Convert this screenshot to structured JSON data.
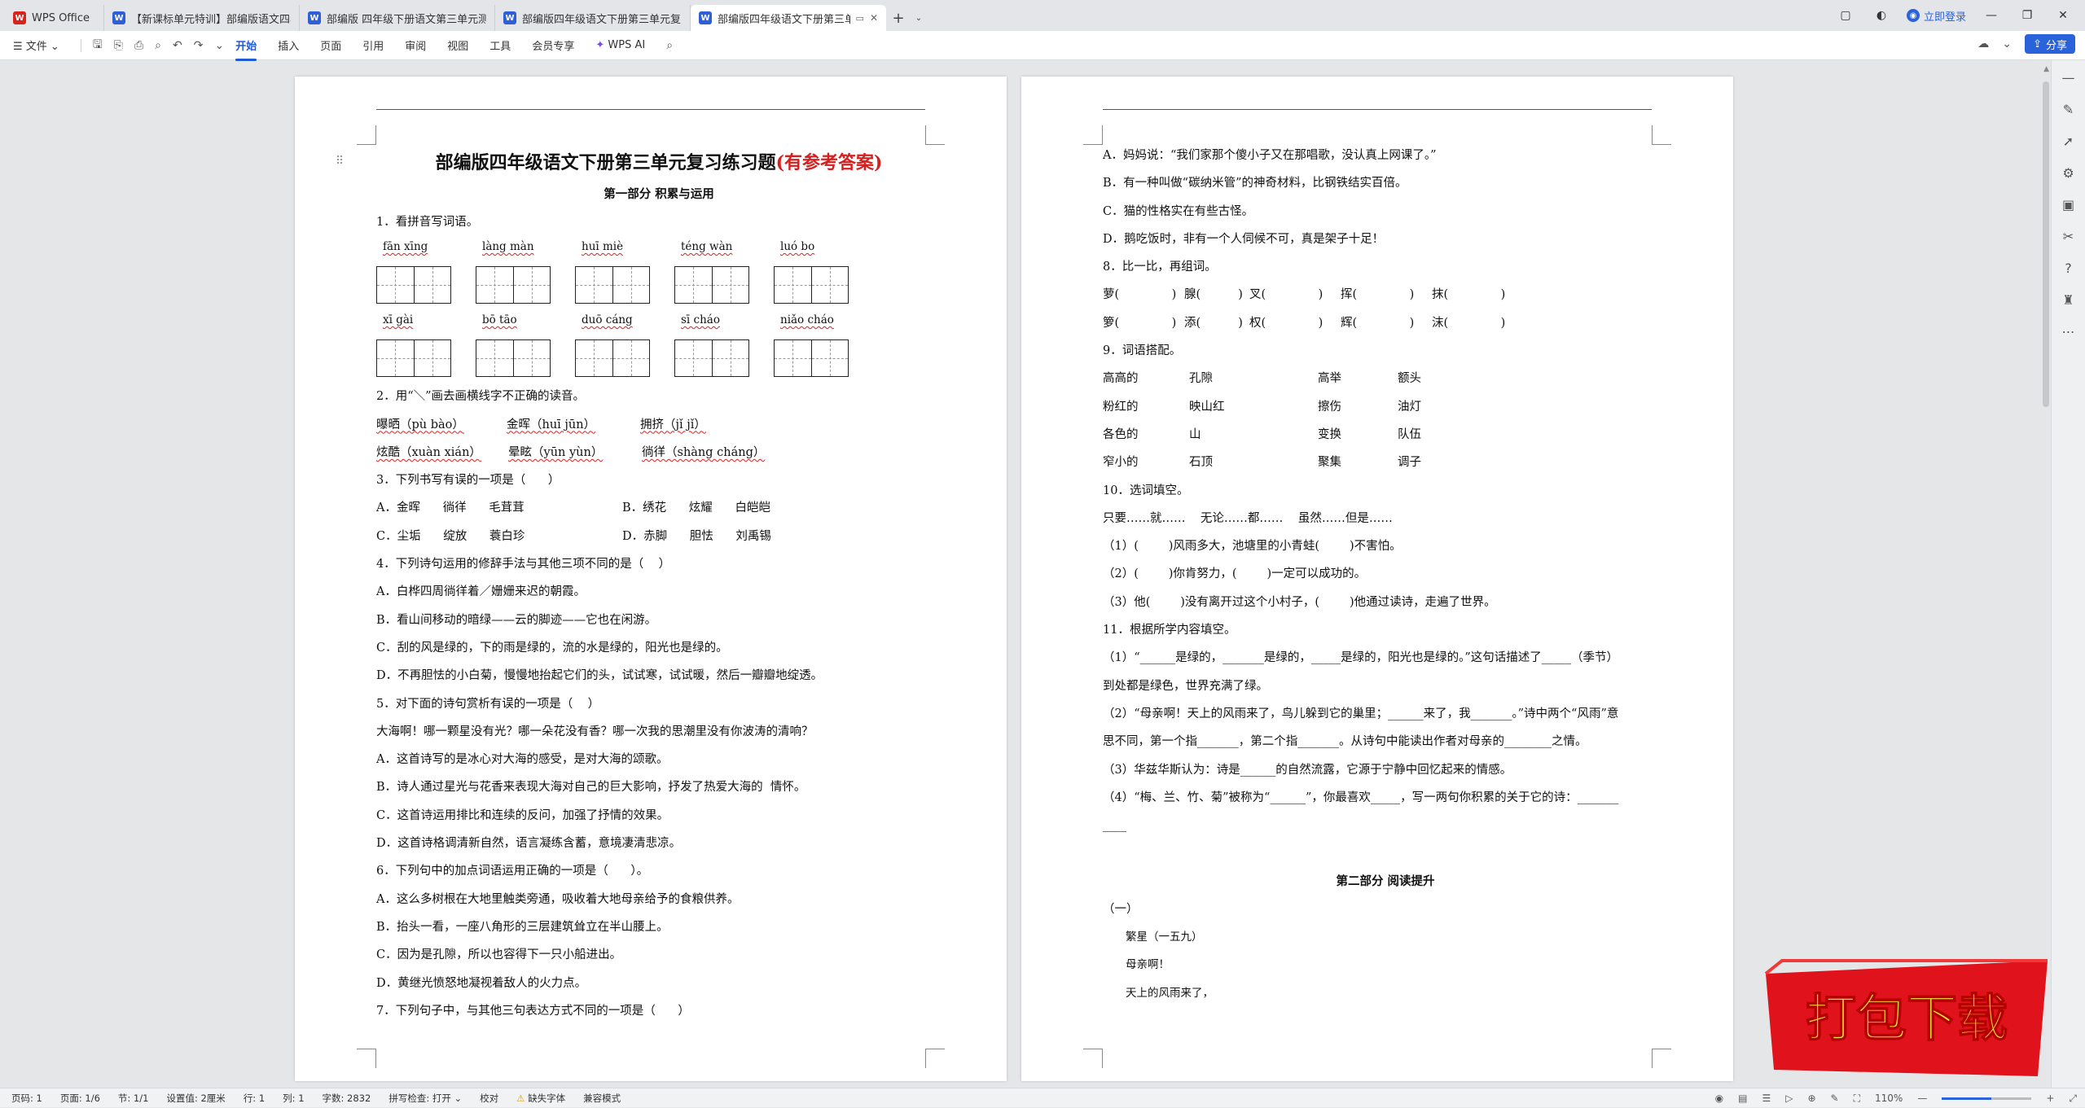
{
  "tabs": [
    {
      "icon": "W",
      "label": "WPS Office",
      "kind": "wps"
    },
    {
      "icon": "W",
      "label": "【新课标单元特训】部编版语文四年",
      "kind": "w"
    },
    {
      "icon": "W",
      "label": "部编版 四年级下册语文第三单元测试",
      "kind": "w"
    },
    {
      "icon": "W",
      "label": "部编版四年级语文下册第三单元复习",
      "kind": "w"
    },
    {
      "icon": "W",
      "label": "部编版四年级语文下册第三单",
      "kind": "w",
      "active": true
    }
  ],
  "window": {
    "login": "立即登录",
    "share": "分享"
  },
  "menu": {
    "file": "☰ 文件 ⌄",
    "items": [
      "开始",
      "插入",
      "页面",
      "引用",
      "审阅",
      "视图",
      "工具",
      "会员专享"
    ],
    "ai": "WPS AI"
  },
  "page1": {
    "title_main": "部编版四年级语文下册第三单元复习练习题",
    "title_red": "(有参考答案)",
    "part1": "第一部分    积累与运用",
    "q1": "1．看拼音写词语。",
    "py_row1": [
      "fān  xīng",
      "làng  màn",
      "huī  miè",
      "téng  wàn",
      "luó  bo"
    ],
    "py_row2": [
      "xī    gài",
      "bō   tāo",
      "duō  cáng",
      "sī    cháo",
      "niǎo  cháo"
    ],
    "q2": "2．用“＼”画去画横线字不正确的读音。",
    "q2a": [
      "曝晒（pù bào）",
      "金晖（huī jūn）",
      "拥挤（jǐ jǐ）"
    ],
    "q2b": [
      "炫酷（xuàn xián）",
      "晕眩（yūn yùn）",
      "徜徉（shàng cháng）"
    ],
    "q3": "3．下列书写有误的一项是（      ）",
    "q3a": [
      "A．金晖      徜徉      毛茸茸",
      "B．绣花      炫耀      白皑皑"
    ],
    "q3b": [
      "C．尘垢      绽放      蓑白珍",
      "D．赤脚      胆怯      刘禹锡"
    ],
    "q4": "4．下列诗句运用的修辞手法与其他三项不同的是（    ）",
    "q4a": "A．白桦四周徜徉着／姗姗来迟的朝霞。",
    "q4b": "B．看山间移动的暗绿——云的脚迹——它也在闲游。",
    "q4c": "C．刮的风是绿的，下的雨是绿的，流的水是绿的，阳光也是绿的。",
    "q4d": "D．不再胆怯的小白菊，慢慢地抬起它们的头，试试寒，试试暖，然后一瓣瓣地绽透。",
    "q5": "5．对下面的诗句赏析有误的一项是（    ）",
    "q5s": "大海啊！哪一颗星没有光？哪一朵花没有香？哪一次我的思潮里没有你波涛的清响？",
    "q5a": "A．这首诗写的是冰心对大海的感受，是对大海的颂歌。",
    "q5b": "B．诗人通过星光与花香来表现大海对自己的巨大影响，抒发了热爱大海的  情怀。",
    "q5c": "C．这首诗运用排比和连续的反问，加强了抒情的效果。",
    "q5d": "D．这首诗格调清新自然，语言凝练含蓄，意境凄清悲凉。",
    "q6": "6．下列句中的加点词语运用正确的一项是（      ）。",
    "q6a": "A．这么多树根在大地里触类旁通，吸收着大地母亲给予的食粮供养。",
    "q6b": "B．抬头一看，一座八角形的三层建筑耸立在半山腰上。",
    "q6c": "C．因为是孔隙，所以也容得下一只小船进出。",
    "q6d": "D．黄继光愤怒地凝视着敌人的火力点。",
    "q7": "7．下列句子中，与其他三句表达方式不同的一项是（      ）"
  },
  "page2": {
    "l1": "A．妈妈说：“我们家那个傻小子又在那唱歌，没认真上网课了。”",
    "l2": "B．有一种叫做“碳纳米管”的神奇材料，比钢铁结实百倍。",
    "l3": "C．猫的性格实在有些古怪。",
    "l4": "D．鹅吃饭时，非有一个人伺候不可，真是架子十足！",
    "q8": "8．比一比，再组词。",
    "q8a": [
      "萝(              )",
      "腺(          )",
      "叉(              )",
      "挥(              )",
      "抹(              )"
    ],
    "q8b": [
      "箩(              )",
      "添(          )",
      "权(              )",
      "辉(              )",
      "沫(              )"
    ],
    "q9": "9．词语搭配。",
    "q9r1": [
      "高高的",
      "孔隙",
      "高举",
      "额头"
    ],
    "q9r2": [
      "粉红的",
      "映山红",
      "擦伤",
      "油灯"
    ],
    "q9r3": [
      "各色的",
      "山",
      "变换",
      "队伍"
    ],
    "q9r4": [
      "窄小的",
      "石顶",
      "聚集",
      "调子"
    ],
    "q10": "10．选词填空。",
    "q10w": "只要……就……    无论……都……    虽然……但是……",
    "q10a": "（1）(        )风雨多大，池塘里的小青蛙(        )不害怕。",
    "q10b": "（2）(        )你肯努力，(        )一定可以成功的。",
    "q10c": "（3）他(        )没有离开过这个小村子，(        )他通过读诗，走遍了世界。",
    "q11": "11．根据所学内容填空。",
    "q11a": "（1）“______是绿的，_______是绿的，_____是绿的，阳光也是绿的。”这句话描述了_____（季节）",
    "q11a2": "到处都是绿色，世界充满了绿。",
    "q11b": "（2）“母亲啊！天上的风雨来了，鸟儿躲到它的巢里；______来了，我_______。”诗中两个“风雨”意",
    "q11b2": "思不同，第一个指_______，第二个指_______。从诗句中能读出作者对母亲的________之情。",
    "q11c": "（3）华兹华斯认为：诗是______的自然流露，它源于宁静中回忆起来的情感。",
    "q11d": "（4）“梅、兰、竹、菊”被称为“______”，你最喜欢_____，写一两句你积累的关于它的诗：_______",
    "q11d2": "____",
    "part2": "第二部分    阅读提升",
    "p1": "（一）",
    "poem_title": "繁星（一五九）",
    "poem_l1": "母亲啊！",
    "poem_l2": "天上的风雨来了，"
  },
  "status": {
    "page": "页码: 1",
    "pages": "页面: 1/6",
    "section": "节: 1/1",
    "setting": "设置值: 2厘米",
    "row": "行: 1",
    "col": "列: 1",
    "words": "字数: 2832",
    "spell": "拼写检查: 打开 ⌄",
    "proof": "校对",
    "missing_font": "缺失字体",
    "compat": "兼容模式",
    "zoom": "110%",
    "zoom_level": 0.55
  },
  "banner": {
    "text": "打包下载",
    "bg": "#e0121b",
    "fg": "#ffe63b"
  }
}
